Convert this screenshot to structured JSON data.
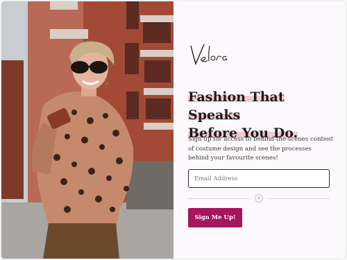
{
  "brand": {
    "logo_text": "Velora"
  },
  "hero": {
    "title_line1": "Fashion That Speaks",
    "title_line2": "Before You Do."
  },
  "intro": {
    "text": "Sign up for access to behind-the-scenes content of costume design and see the processes behind your favourite scenes!"
  },
  "form": {
    "email_placeholder": "Email Address",
    "submit_label": "Sign Me Up!"
  },
  "colors": {
    "accent": "#a6165c",
    "highlight": "#f1cbd1",
    "background": "#fbf9fb"
  },
  "icons": {
    "divider": "plus-circle-icon"
  }
}
